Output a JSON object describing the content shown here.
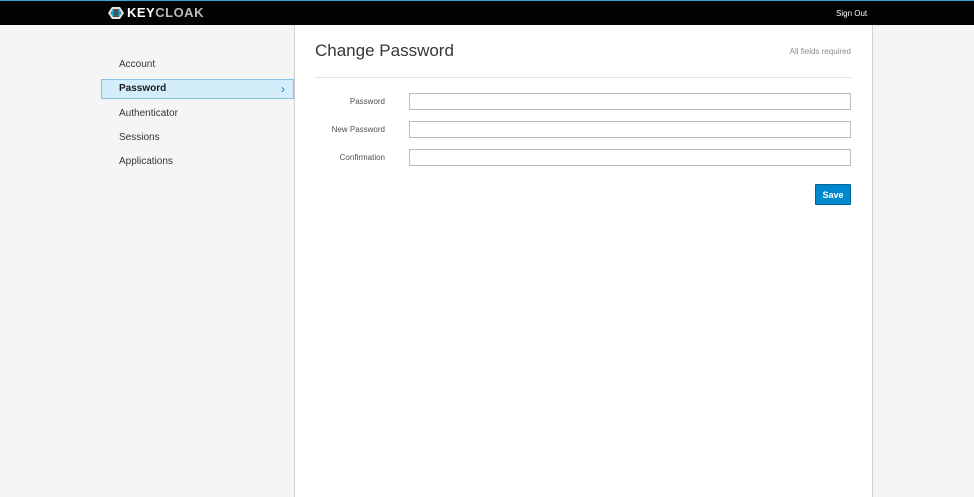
{
  "header": {
    "brand": "KEYCLOAK",
    "brand_primary": "KEY",
    "brand_secondary": "CLOAK",
    "signout_label": "Sign Out",
    "logo_icon": "keycloak-logo-icon",
    "accent_color": "#39a5dc"
  },
  "sidebar": {
    "items": [
      {
        "label": "Account",
        "active": false
      },
      {
        "label": "Password",
        "active": true
      },
      {
        "label": "Authenticator",
        "active": false
      },
      {
        "label": "Sessions",
        "active": false
      },
      {
        "label": "Applications",
        "active": false
      }
    ],
    "active_chevron": "›"
  },
  "main": {
    "title": "Change Password",
    "subtitle": "All fields required",
    "fields": [
      {
        "label": "Password",
        "value": "",
        "placeholder": ""
      },
      {
        "label": "New Password",
        "value": "",
        "placeholder": ""
      },
      {
        "label": "Confirmation",
        "value": "",
        "placeholder": ""
      }
    ],
    "save_label": "Save",
    "primary_color": "#0088ce"
  }
}
